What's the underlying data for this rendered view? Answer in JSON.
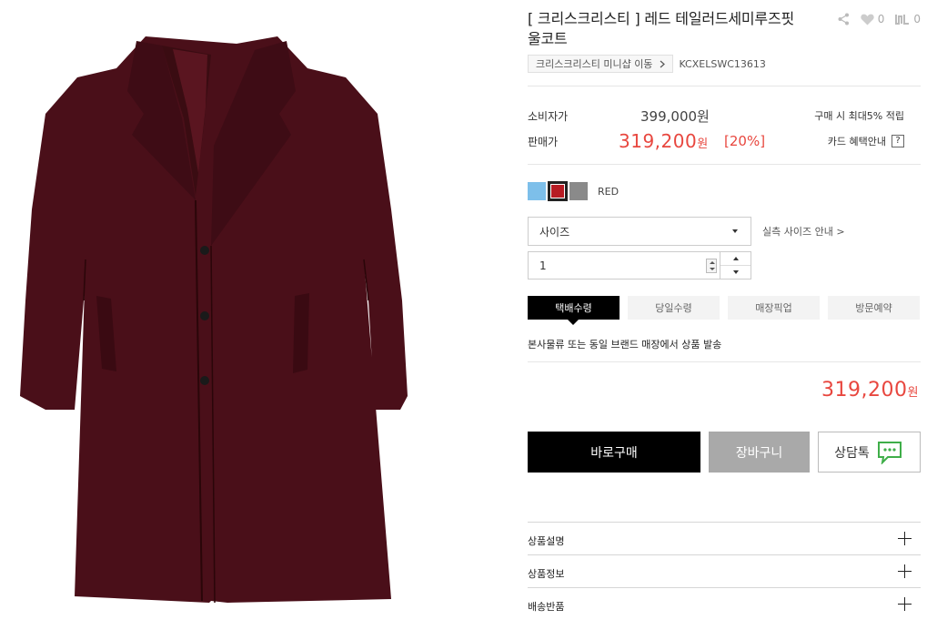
{
  "product": {
    "title": "[ 크리스크리스티 ] 레드 테일러드세미루즈핏울코트",
    "image_alt": "product-photo",
    "share_count": "0",
    "like_count": "0",
    "brand_button": "크리스크리스티 미니샵 이동",
    "code": "KCXELSWC13613"
  },
  "price": {
    "consumer_label": "소비자가",
    "consumer_value": "399,000원",
    "sale_label": "판매가",
    "sale_value": "319,200",
    "sale_won": "원",
    "discount_rate": "[20%]",
    "point_text": "구매 시 최대5% 적립",
    "card_text": "카드 혜택안내",
    "card_help": "?"
  },
  "colors": {
    "options": [
      {
        "name": "blue",
        "hex": "#7dbfea"
      },
      {
        "name": "red",
        "hex": "#b71c24"
      },
      {
        "name": "grey",
        "hex": "#8a8a8a"
      }
    ],
    "selected_label": "RED"
  },
  "size": {
    "placeholder": "사이즈",
    "guide_link": "실측 사이즈 안내 >"
  },
  "quantity": {
    "value": "1"
  },
  "shipping": {
    "tabs": [
      "택배수령",
      "당일수령",
      "매장픽업",
      "방문예약"
    ],
    "active_index": 0,
    "description": "본사물류 또는 동일 브랜드 매장에서 상품 발송"
  },
  "total": {
    "value": "319,200",
    "won": "원"
  },
  "actions": {
    "buy": "바로구매",
    "cart": "장바구니",
    "talk": "상담톡"
  },
  "accordion": {
    "items": [
      "상품설명",
      "상품정보",
      "배송반품"
    ]
  },
  "icons": {
    "share": "share-icon",
    "heart": "heart-icon",
    "brand": "brand-icon",
    "chat": "chat-icon"
  },
  "theme": {
    "accent_red": "#e8473f",
    "black": "#000000",
    "coat_color": "#4a0f19"
  }
}
